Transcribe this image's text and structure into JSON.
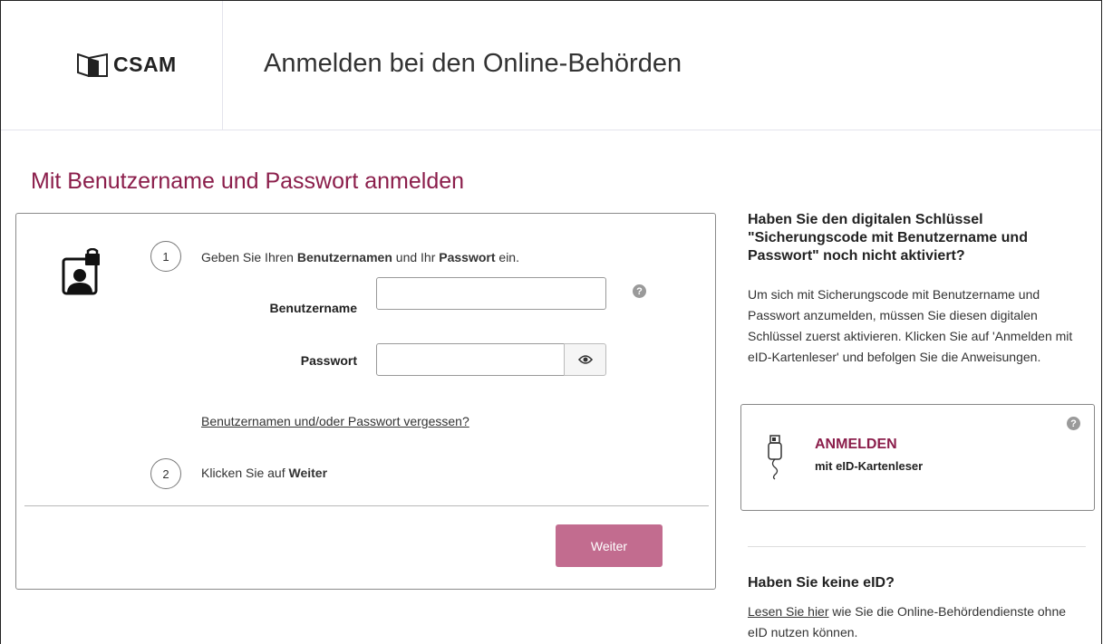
{
  "header": {
    "logo_text": "CSAM",
    "title": "Anmelden bei den Online-Behörden"
  },
  "page_heading": "Mit Benutzername und Passwort anmelden",
  "login_card": {
    "step1_number": "1",
    "step1_text_pre": "Geben Sie Ihren ",
    "step1_text_bold1": "Benutzernamen",
    "step1_text_mid": " und Ihr ",
    "step1_text_bold2": "Passwort",
    "step1_text_post": " ein.",
    "username_label": "Benutzername",
    "username_value": "",
    "password_label": "Passwort",
    "password_value": "",
    "help_symbol": "?",
    "forgot_link": "Benutzernamen und/oder Passwort vergessen?",
    "step2_number": "2",
    "step2_text_pre": "Klicken Sie auf ",
    "step2_text_bold": "Weiter",
    "submit_label": "Weiter"
  },
  "side": {
    "heading": "Haben Sie den digitalen Schlüssel \"Sicherungscode mit Benutzername und Passwort\" noch nicht aktiviert?",
    "paragraph": "Um sich mit Sicherungscode mit Benutzername und Passwort anzumelden, müssen Sie diesen digitalen Schlüssel zuerst aktivieren. Klicken Sie auf 'Anmelden mit eID-Kartenleser' und befolgen Sie die Anweisungen.",
    "eid_title": "ANMELDEN",
    "eid_subtitle": "mit eID-Kartenleser",
    "help_symbol": "?",
    "no_eid_heading": "Haben Sie keine eID?",
    "no_eid_link": "Lesen Sie hier",
    "no_eid_text": " wie Sie die Online-Behördendienste ohne eID nutzen können."
  },
  "colors": {
    "accent": "#8b1e4b",
    "button": "#c26c8f"
  },
  "icons": [
    "csam-logo-icon",
    "user-lock-icon",
    "eye-icon",
    "help-icon",
    "card-reader-icon"
  ]
}
